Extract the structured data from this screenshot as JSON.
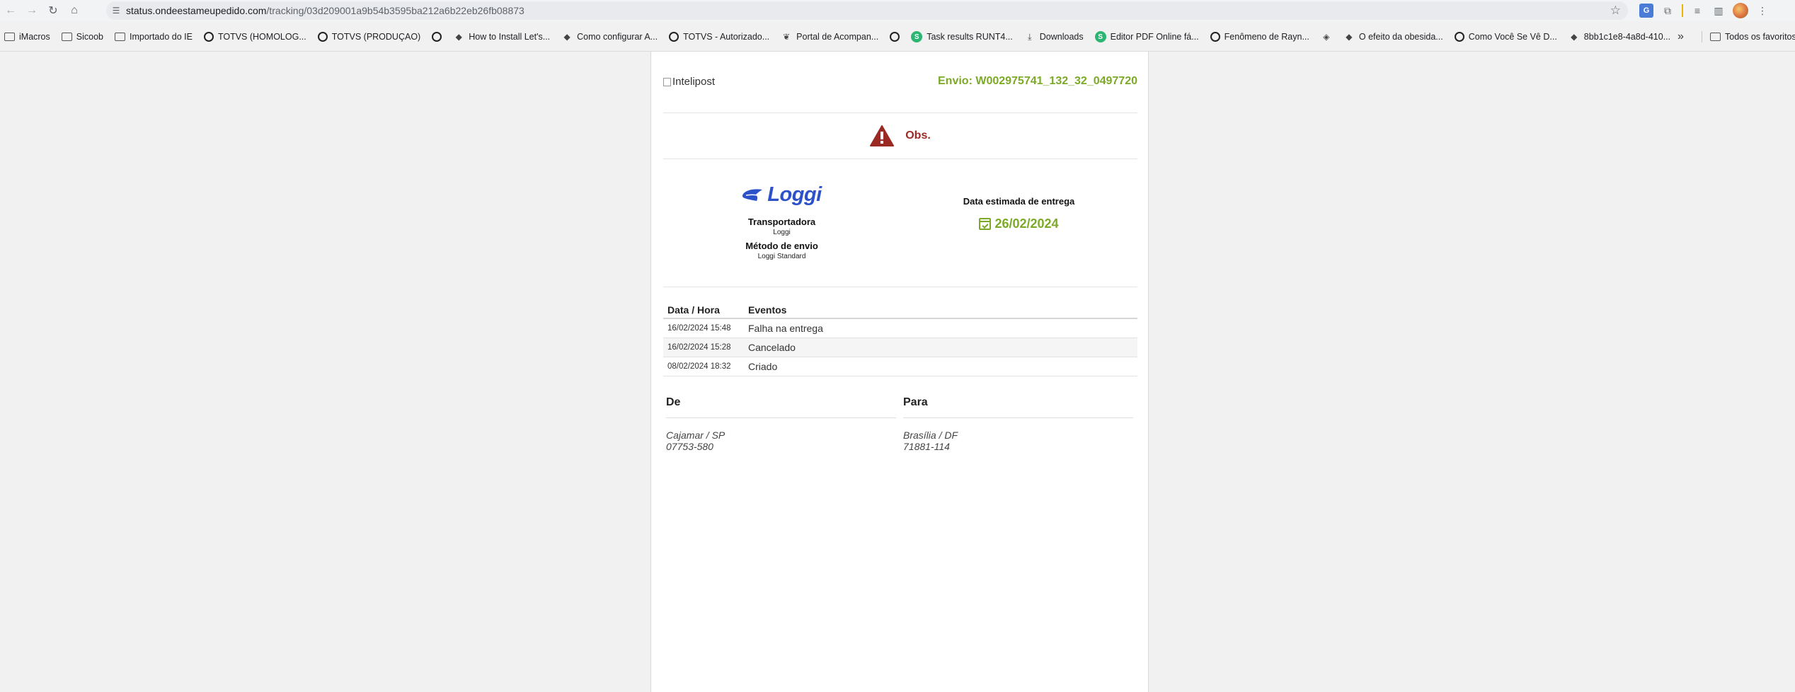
{
  "browser": {
    "url_host": "status.ondeestameupedido.com",
    "url_path": "/tracking/03d209001a9b54b3595ba212a6b22eb26fb08873"
  },
  "bookmarks": [
    {
      "label": "iMacros",
      "icon": "folder-icon"
    },
    {
      "label": "Sicoob",
      "icon": "folder-icon"
    },
    {
      "label": "Importado do IE",
      "icon": "folder-icon"
    },
    {
      "label": "TOTVS (HOMOLOG...",
      "icon": "totvs-icon"
    },
    {
      "label": "TOTVS (PRODUÇAO)",
      "icon": "totvs-icon"
    },
    {
      "label": "",
      "icon": "totvs-icon"
    },
    {
      "label": "How to Install Let's...",
      "icon": "bookmark-icon"
    },
    {
      "label": "Como configurar A...",
      "icon": "bookmark-icon"
    },
    {
      "label": "TOTVS - Autorizado...",
      "icon": "totvs-icon"
    },
    {
      "label": "Portal de Acompan...",
      "icon": "leaf-icon"
    },
    {
      "label": "",
      "icon": "totvs-icon"
    },
    {
      "label": "Task results RUNT4...",
      "icon": "s-icon"
    },
    {
      "label": "Downloads",
      "icon": "download-icon"
    },
    {
      "label": "Editor PDF Online fá...",
      "icon": "s-icon"
    },
    {
      "label": "Fenômeno de Rayn...",
      "icon": "totvs-icon"
    },
    {
      "label": "",
      "icon": "diamond-icon"
    },
    {
      "label": "O efeito da obesida...",
      "icon": "bookmark-icon"
    },
    {
      "label": "Como Você Se Vê D...",
      "icon": "totvs-icon"
    },
    {
      "label": "8bb1c1e8-4a8d-410...",
      "icon": "bookmark-icon"
    }
  ],
  "bookmarks_overflow": "»",
  "all_bookmarks_label": "Todos os favoritos",
  "tracking": {
    "logo_alt": "Intelipost",
    "shipment_label": "Envio: W002975741_132_32_0497720",
    "obs_label": "Obs.",
    "carrier_logo_text": "Loggi",
    "carrier_label": "Transportadora",
    "carrier_value": "Loggi",
    "method_label": "Método de envio",
    "method_value": "Loggi Standard",
    "eta_label": "Data estimada de entrega",
    "eta_value": "26/02/2024",
    "events_header_date": "Data / Hora",
    "events_header_event": "Eventos",
    "events": [
      {
        "date": "16/02/2024 15:48",
        "event": "Falha na entrega"
      },
      {
        "date": "16/02/2024 15:28",
        "event": "Cancelado"
      },
      {
        "date": "08/02/2024 18:32",
        "event": "Criado"
      }
    ],
    "from_title": "De",
    "from_city": "Cajamar / SP",
    "from_zip": "07753-580",
    "to_title": "Para",
    "to_city": "Brasília / DF",
    "to_zip": "71881-114"
  },
  "colors": {
    "accent_green": "#7caa28",
    "warning_red": "#9b2a24",
    "loggi_blue": "#2d51c9"
  }
}
